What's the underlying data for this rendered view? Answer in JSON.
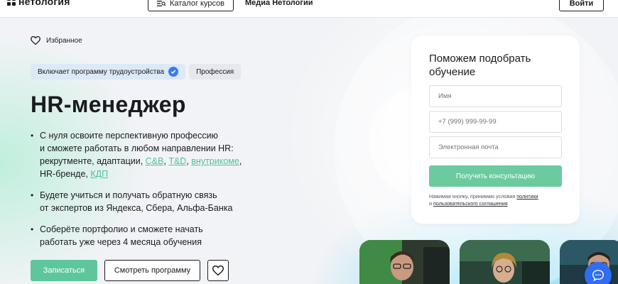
{
  "header": {
    "logo_text": "нетология",
    "catalog_label": "Каталог курсов",
    "media_label": "Медиа Нетологии",
    "login_label": "Войти"
  },
  "favorites_label": "Избранное",
  "badges": {
    "employment": "Включает программу трудоустройства",
    "type": "Профессия"
  },
  "course_title": "HR-менеджер",
  "bullets": {
    "b1": {
      "line1": "С нуля освоите перспективную профессию",
      "line2": "и сможете работать в любом направлении HR:",
      "line3_prefix": "рекрутменте, адаптации, ",
      "link_cb": "С&В",
      "link_td": "Т&D",
      "link_internal": "внутрикоме",
      "line4_prefix": "HR-бренде, ",
      "link_kdp": "КДП"
    },
    "b2": {
      "line1": "Будете учиться и получать обратную связь",
      "line2": "от экспертов из Яндекса, Сбера, Альфа-Банка"
    },
    "b3": {
      "line1": "Соберёте портфолио и сможете начать",
      "line2": "работать уже через 4 месяца обучения"
    }
  },
  "actions": {
    "enroll_label": "Записаться",
    "view_program_label": "Смотреть программу"
  },
  "form": {
    "title": "Поможем подобрать обучение",
    "name_placeholder": "Имя",
    "phone_placeholder": "+7 (999) 999-99-99",
    "email_placeholder": "Электронная почта",
    "submit_label": "Получить консультацию",
    "consent_prefix": "Нажимая кнопку, принимаю условия ",
    "consent_policy": "политики",
    "consent_mid": "и ",
    "consent_agreement": "пользовательского соглашения"
  },
  "colors": {
    "accent_green": "#5dc79b",
    "link_green": "#4fc296",
    "verified_blue": "#3d7bf2",
    "chat_blue": "#2f6df2"
  },
  "icons": [
    "catalog-icon",
    "heart-icon",
    "verified-check-icon",
    "chat-icon"
  ]
}
